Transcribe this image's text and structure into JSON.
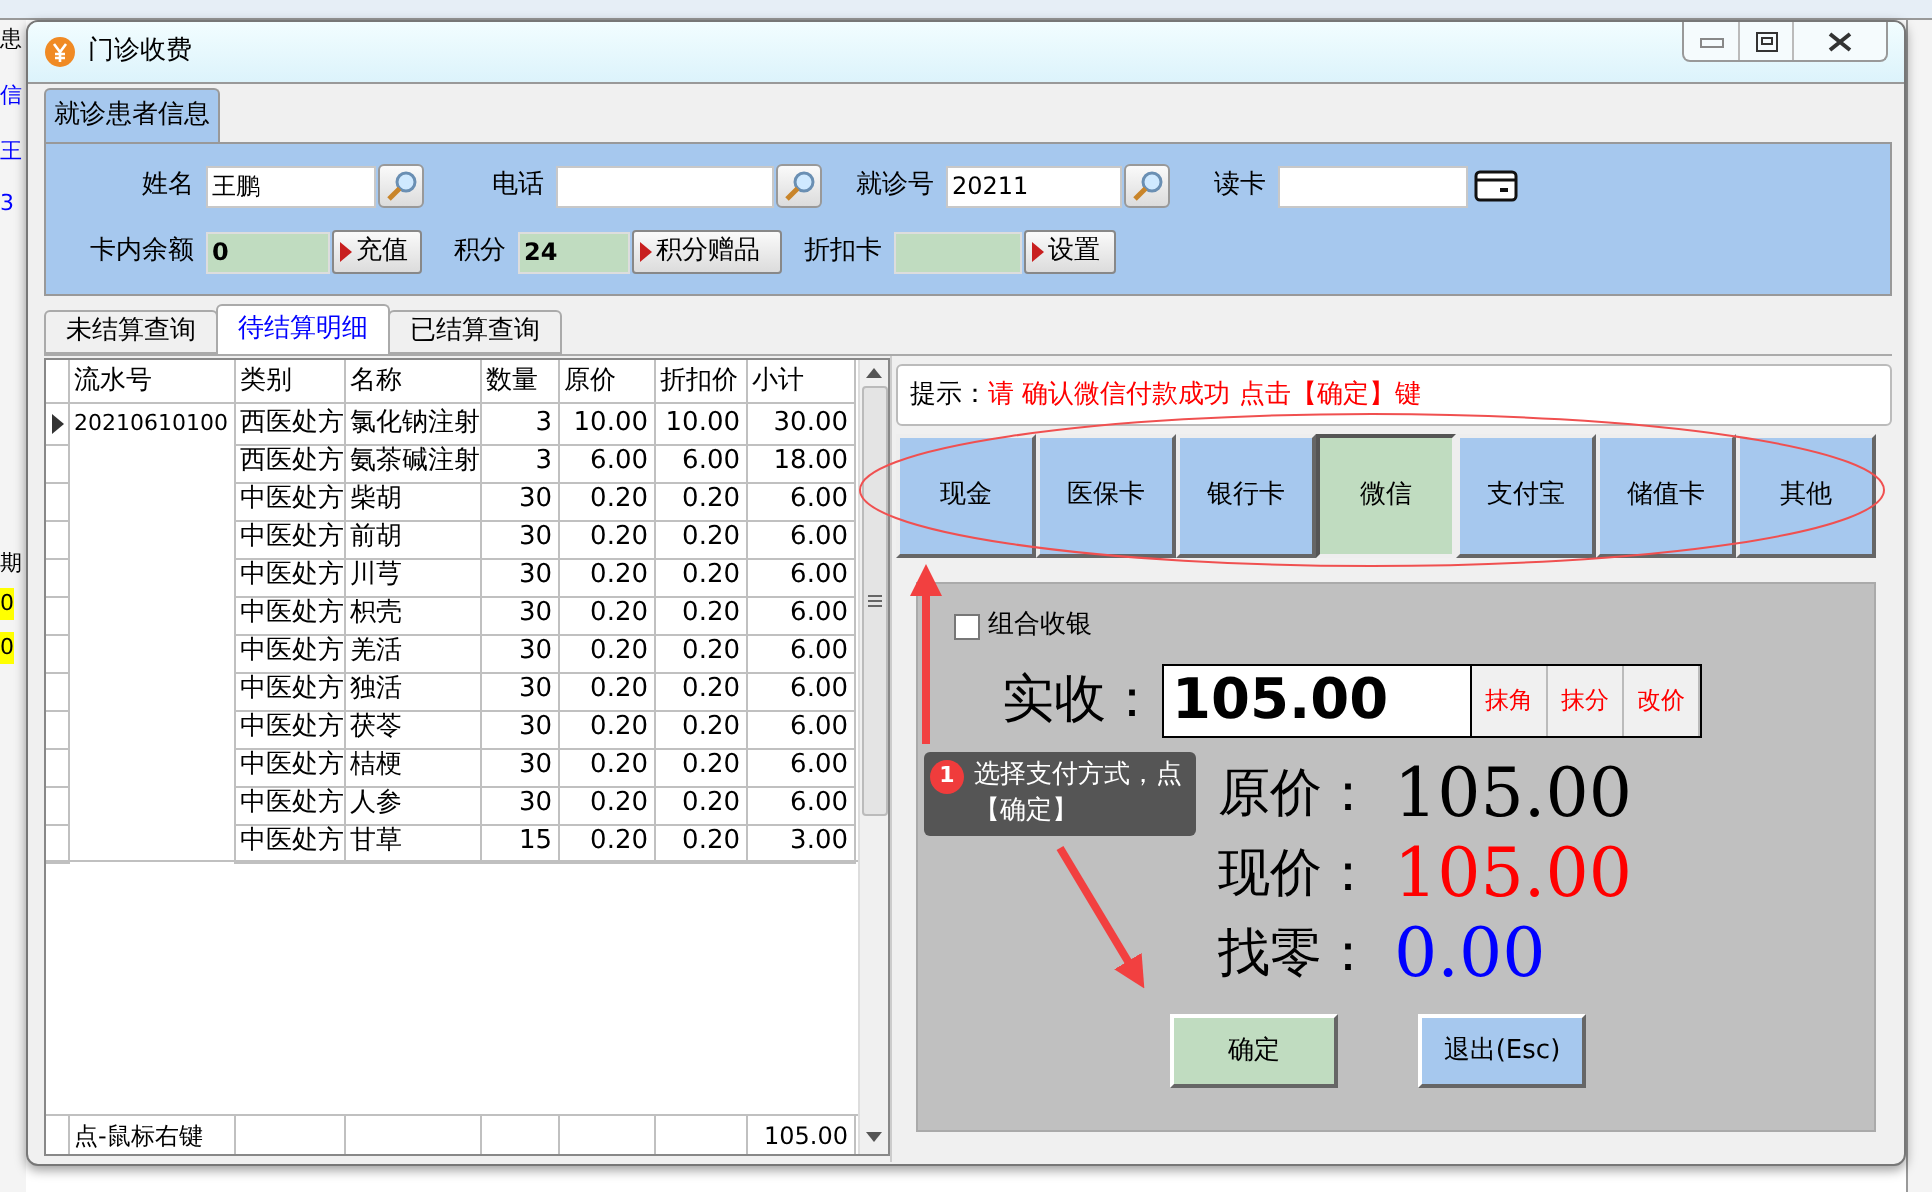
{
  "background_fragments": [
    {
      "text": "患",
      "kind": "plain"
    },
    {
      "text": "信",
      "kind": "link"
    },
    {
      "text": "王",
      "kind": "link"
    },
    {
      "text": "3",
      "kind": "link"
    },
    {
      "text": "期",
      "kind": "plain"
    },
    {
      "text": "0",
      "kind": "highlight"
    },
    {
      "text": "0",
      "kind": "highlight"
    }
  ],
  "window": {
    "title": "门诊收费"
  },
  "patient_group": {
    "title": "就诊患者信息",
    "row_1": [
      {
        "label": "姓名",
        "value": "王鹏",
        "kind": "search"
      },
      {
        "label": "电话",
        "kind": "search"
      },
      {
        "label": "就诊号",
        "value": "20211",
        "kind": "search"
      },
      {
        "label": "读卡",
        "kind": "card"
      }
    ],
    "row_2": [
      {
        "label": "卡内余额",
        "value": "0",
        "button": "充值"
      },
      {
        "label": "积分",
        "value": "24",
        "button": "积分赠品"
      },
      {
        "label": "折扣卡",
        "button": "设置"
      }
    ]
  },
  "tabs": [
    {
      "label": "未结算查询",
      "selected": false
    },
    {
      "label": "待结算明细",
      "selected": true
    },
    {
      "label": "已结算查询",
      "selected": false
    }
  ],
  "table": {
    "columns": [
      "流水号",
      "类别",
      "名称",
      "数量",
      "原价",
      "折扣价",
      "小计"
    ],
    "rows": [
      {
        "current": true,
        "cells": [
          "20210610100",
          "西医处方",
          "氯化钠注射",
          "3",
          "10.00",
          "10.00",
          "30.00"
        ]
      },
      {
        "current": false,
        "cells": [
          "",
          "西医处方",
          "氨茶碱注射",
          "3",
          "6.00",
          "6.00",
          "18.00"
        ]
      },
      {
        "current": false,
        "cells": [
          "",
          "中医处方",
          "柴胡",
          "30",
          "0.20",
          "0.20",
          "6.00"
        ]
      },
      {
        "current": false,
        "cells": [
          "",
          "中医处方",
          "前胡",
          "30",
          "0.20",
          "0.20",
          "6.00"
        ]
      },
      {
        "current": false,
        "cells": [
          "",
          "中医处方",
          "川芎",
          "30",
          "0.20",
          "0.20",
          "6.00"
        ]
      },
      {
        "current": false,
        "cells": [
          "",
          "中医处方",
          "枳壳",
          "30",
          "0.20",
          "0.20",
          "6.00"
        ]
      },
      {
        "current": false,
        "cells": [
          "",
          "中医处方",
          "羌活",
          "30",
          "0.20",
          "0.20",
          "6.00"
        ]
      },
      {
        "current": false,
        "cells": [
          "",
          "中医处方",
          "独活",
          "30",
          "0.20",
          "0.20",
          "6.00"
        ]
      },
      {
        "current": false,
        "cells": [
          "",
          "中医处方",
          "茯苓",
          "30",
          "0.20",
          "0.20",
          "6.00"
        ]
      },
      {
        "current": false,
        "cells": [
          "",
          "中医处方",
          "桔梗",
          "30",
          "0.20",
          "0.20",
          "6.00"
        ]
      },
      {
        "current": false,
        "cells": [
          "",
          "中医处方",
          "人参",
          "30",
          "0.20",
          "0.20",
          "6.00"
        ]
      },
      {
        "current": false,
        "cells": [
          "",
          "中医处方",
          "甘草",
          "15",
          "0.20",
          "0.20",
          "3.00"
        ]
      }
    ],
    "footer": {
      "note": "点-鼠标右键",
      "total": "105.00"
    }
  },
  "payment": {
    "hint_label": "提示：",
    "hint_message": "请 确认微信付款成功 点击【确定】键",
    "methods": [
      {
        "label": "现金",
        "selected": false
      },
      {
        "label": "医保卡",
        "selected": false
      },
      {
        "label": "银行卡",
        "selected": false
      },
      {
        "label": "微信",
        "selected": true
      },
      {
        "label": "支付宝",
        "selected": false
      },
      {
        "label": "储值卡",
        "selected": false
      },
      {
        "label": "其他",
        "selected": false
      }
    ],
    "combined_checkout": {
      "label": "组合收银",
      "checked": false
    },
    "received": {
      "label": "实收：",
      "value": "105.00",
      "buttons": [
        "抹角",
        "抹分",
        "改价"
      ]
    },
    "summary": [
      {
        "label": "原价：",
        "value": "105.00",
        "color": "#000000"
      },
      {
        "label": "现价：",
        "value": "105.00",
        "color": "#ff0000"
      },
      {
        "label": "找零：",
        "value": "0.00",
        "color": "#0000ff"
      }
    ],
    "actions": [
      {
        "label": "确定",
        "kind": "confirm"
      },
      {
        "label": "退出(Esc)",
        "kind": "exit"
      }
    ]
  },
  "annotation": {
    "badge": "1",
    "text": "选择支付方式，点【确定】"
  }
}
